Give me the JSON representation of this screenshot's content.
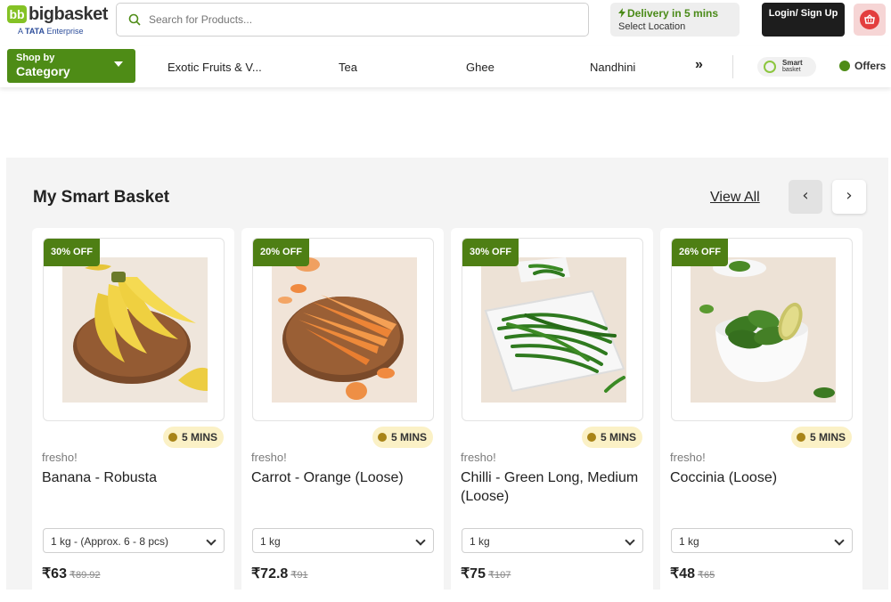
{
  "header": {
    "logo_mark": "bb",
    "logo_text": "bigbasket",
    "logo_sub_prefix": "A ",
    "logo_sub_brand": "TATA",
    "logo_sub_suffix": " Enterprise",
    "search_placeholder": "Search for Products...",
    "delivery_title": "Delivery in 5 mins",
    "delivery_sub": "Select Location",
    "login_label": "Login/ Sign Up",
    "icons": {
      "search": "search-icon",
      "bolt": "lightning-icon",
      "basket": "basket-icon"
    }
  },
  "category_bar": {
    "shopby_small": "Shop by",
    "shopby_big": "Category",
    "links": [
      "Exotic Fruits & V...",
      "Tea",
      "Ghee",
      "Nandhini"
    ],
    "more": "»",
    "smart_line1": "Smart",
    "smart_line2": "basket",
    "offers": "Offers"
  },
  "section": {
    "title": "My Smart Basket",
    "view_all": "View All",
    "prev": "‹",
    "next": "›"
  },
  "products": [
    {
      "discount": "30% OFF",
      "eta": "5 MINS",
      "brand": "fresho!",
      "name": "Banana - Robusta",
      "qty": "1 kg - (Approx. 6 - 8 pcs)",
      "price": "₹63",
      "mrp": "₹89.92"
    },
    {
      "discount": "20% OFF",
      "eta": "5 MINS",
      "brand": "fresho!",
      "name": "Carrot - Orange (Loose)",
      "qty": "1 kg",
      "price": "₹72.8",
      "mrp": "₹91"
    },
    {
      "discount": "30% OFF",
      "eta": "5 MINS",
      "brand": "fresho!",
      "name": "Chilli - Green Long, Medium (Loose)",
      "qty": "1 kg",
      "price": "₹75",
      "mrp": "₹107"
    },
    {
      "discount": "26% OFF",
      "eta": "5 MINS",
      "brand": "fresho!",
      "name": "Coccinia (Loose)",
      "qty": "1 kg",
      "price": "₹48",
      "mrp": "₹65"
    }
  ],
  "colors": {
    "brand_green": "#4e8c16",
    "logo_green": "#84c225",
    "discount_green": "#4e7f14",
    "eta_bg": "#fbf1c6",
    "basket_red": "#e33e3e"
  }
}
